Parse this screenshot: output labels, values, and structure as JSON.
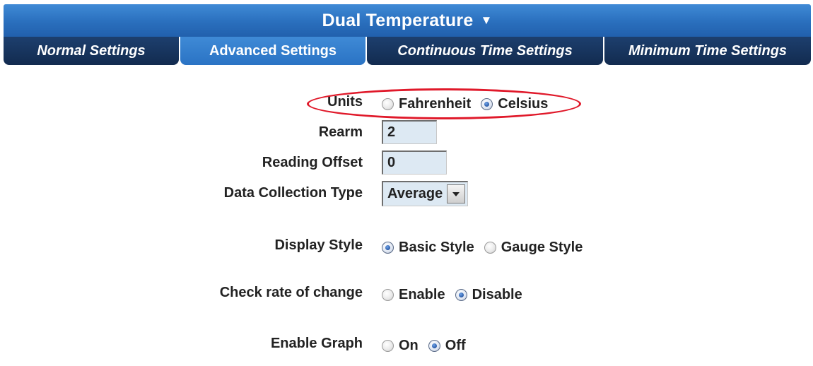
{
  "header": {
    "title": "Dual Temperature",
    "caret": "▼"
  },
  "tabs": [
    {
      "label": "Normal Settings",
      "active": false
    },
    {
      "label": "Advanced Settings",
      "active": true
    },
    {
      "label": "Continuous Time Settings",
      "active": false
    },
    {
      "label": "Minimum Time Settings",
      "active": false
    }
  ],
  "form": {
    "units": {
      "label": "Units",
      "options": [
        "Fahrenheit",
        "Celsius"
      ],
      "selected": "Celsius"
    },
    "rearm": {
      "label": "Rearm",
      "value": "2"
    },
    "reading_offset": {
      "label": "Reading Offset",
      "value": "0"
    },
    "data_collection_type": {
      "label": "Data Collection Type",
      "value": "Average"
    },
    "display_style": {
      "label": "Display Style",
      "options": [
        "Basic Style",
        "Gauge Style"
      ],
      "selected": "Basic Style"
    },
    "check_rate_of_change": {
      "label": "Check rate of change",
      "options": [
        "Enable",
        "Disable"
      ],
      "selected": "Disable"
    },
    "enable_graph": {
      "label": "Enable Graph",
      "options": [
        "On",
        "Off"
      ],
      "selected": "Off"
    }
  },
  "colors": {
    "header_blue": "#2a6fbd",
    "tab_dark": "#122b4f",
    "input_bg": "#dde9f3",
    "highlight_red": "#e0192a"
  }
}
